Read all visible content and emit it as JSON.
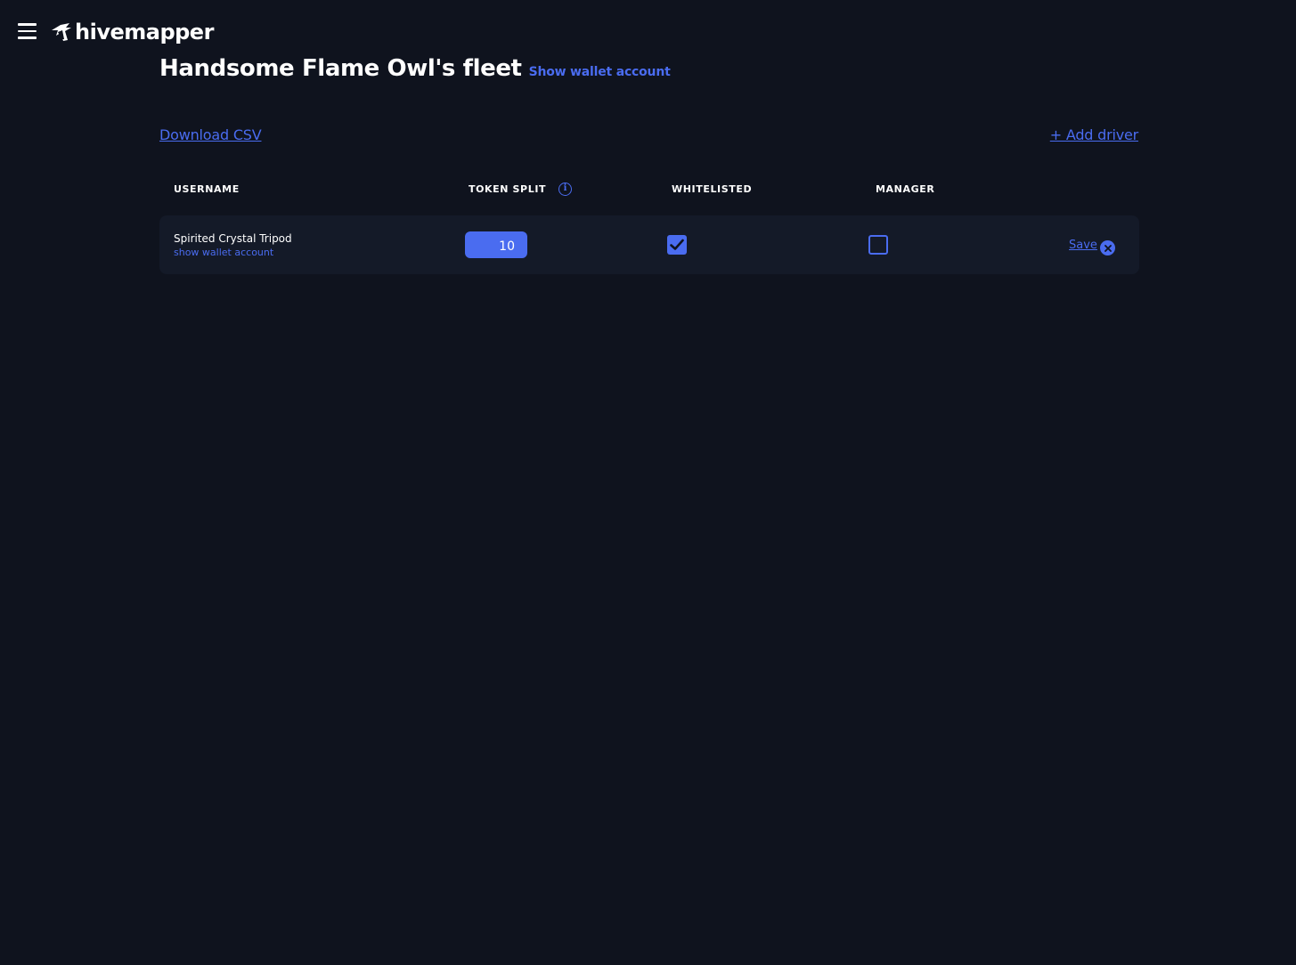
{
  "app": {
    "brand": "hivemapper"
  },
  "page": {
    "title": "Handsome Flame Owl's fleet",
    "show_wallet_label": "Show wallet account"
  },
  "actions": {
    "download_csv": "Download CSV",
    "add_driver": "+ Add driver"
  },
  "table": {
    "headers": {
      "username": "USERNAME",
      "token_split": "TOKEN SPLIT",
      "whitelisted": "WHITELISTED",
      "manager": "MANAGER"
    },
    "rows": [
      {
        "username": "Spirited Crystal Tripod",
        "wallet_link": "show wallet account",
        "token_split": "10",
        "whitelisted": true,
        "manager": false,
        "save_label": "Save"
      }
    ]
  },
  "colors": {
    "background": "#0f131e",
    "row_background": "#141a28",
    "accent": "#4a6cf0",
    "text": "#ffffff"
  },
  "icons": {
    "menu": "hamburger-menu-icon",
    "logo": "hivemapper-bee-logo-icon",
    "info": "info-icon",
    "check": "checkmark-icon",
    "cancel": "close-circle-icon"
  }
}
